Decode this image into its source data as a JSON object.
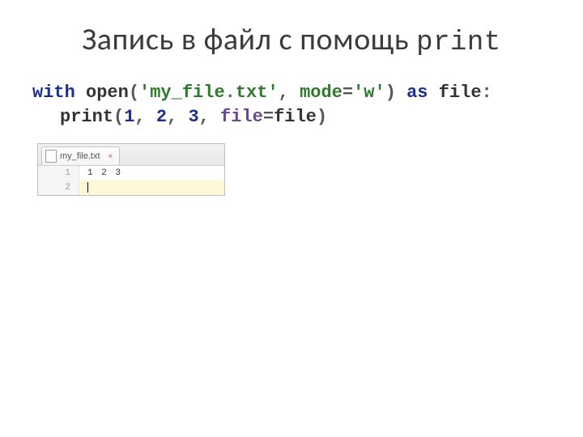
{
  "title_main": "Запись в файл с помощь ",
  "title_mono": "print",
  "code": {
    "kw_with": "with",
    "fn_open": "open",
    "paren_open": "(",
    "str_filename": "'my_file.txt'",
    "comma1": ", ",
    "str_mode_key": "mode",
    "eq1": "=",
    "str_mode_val": "'w'",
    "paren_close": ")",
    "kw_as": "as",
    "ident_file": "file",
    "colon": ":",
    "fn_print": "print",
    "paren_open2": "(",
    "num1": "1",
    "comma2": ", ",
    "num2": "2",
    "comma3": ", ",
    "num3": "3",
    "comma4": ", ",
    "farg_file": "file",
    "eq2": "=",
    "ident_file2": "file",
    "paren_close2": ")"
  },
  "editor": {
    "tab_filename": "my_file.txt",
    "tab_close": "×",
    "rows": {
      "r1_num": "1",
      "r1_text": "1 2 3",
      "r2_num": "2"
    }
  }
}
